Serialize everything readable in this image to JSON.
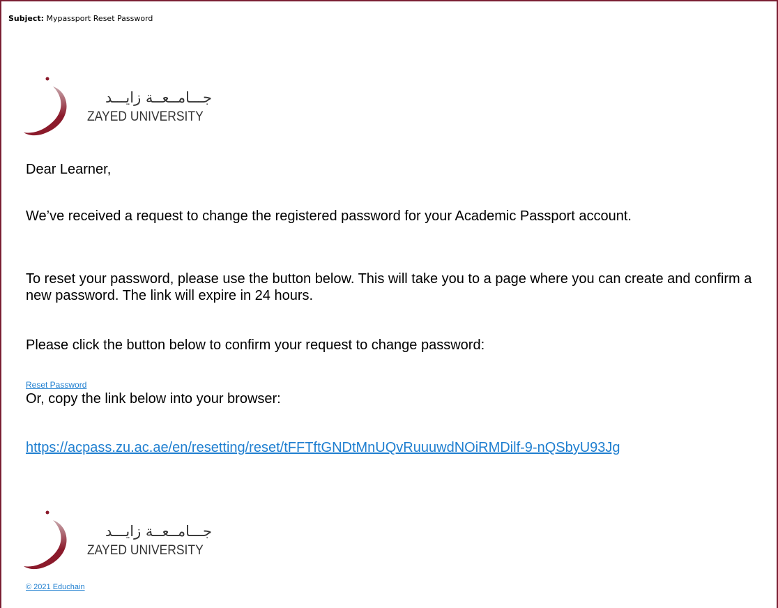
{
  "email": {
    "subject_label": "Subject:",
    "subject": "Mypassport Reset Password",
    "logo": {
      "arabic": "جـــامــعــة زايـــد",
      "english": "ZAYED UNIVERSITY",
      "mark_color": "#8b1a2b"
    },
    "greeting": "Dear Learner,",
    "paragraph1": "We’ve received a request to change the registered password for your Academic Passport account.",
    "paragraph2": "To reset your password, please use the button below. This will take you to a page where you can create and confirm a new password. The link will expire in 24 hours.",
    "paragraph3": "Please click the button below to confirm your request to change password:",
    "reset_link": "Reset Password",
    "paragraph4": "Or, copy the link below into your browser:",
    "url": "https://acpass.zu.ac.ae/en/resetting/reset/tFFTftGNDtMnUQvRuuuwdNOiRMDilf-9-nQSbyU93Jg",
    "copyright": "© 2021 Educhain"
  },
  "colors": {
    "frame_border": "#7a1f33",
    "link": "#1f7fd0",
    "text": "#000000"
  }
}
